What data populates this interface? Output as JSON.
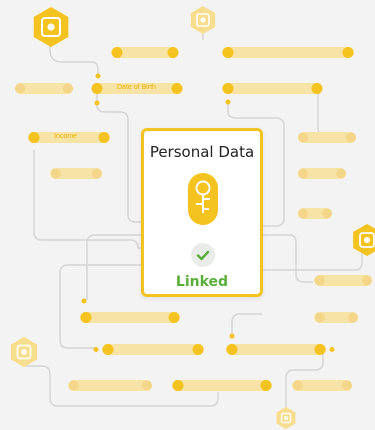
{
  "card": {
    "title": "Personal Data",
    "status": "Linked",
    "icon": "fingerprint-icon",
    "status_icon": "check-icon"
  },
  "labels": {
    "date_of_birth": "Date of Birth",
    "income": "Income"
  },
  "colors": {
    "background": "#f3f3f3",
    "accent": "#f5c31f",
    "accent_light": "#f8e3a6",
    "success": "#5aae3a",
    "line": "#d5d5d5"
  },
  "decor_icon": "lock-icon"
}
